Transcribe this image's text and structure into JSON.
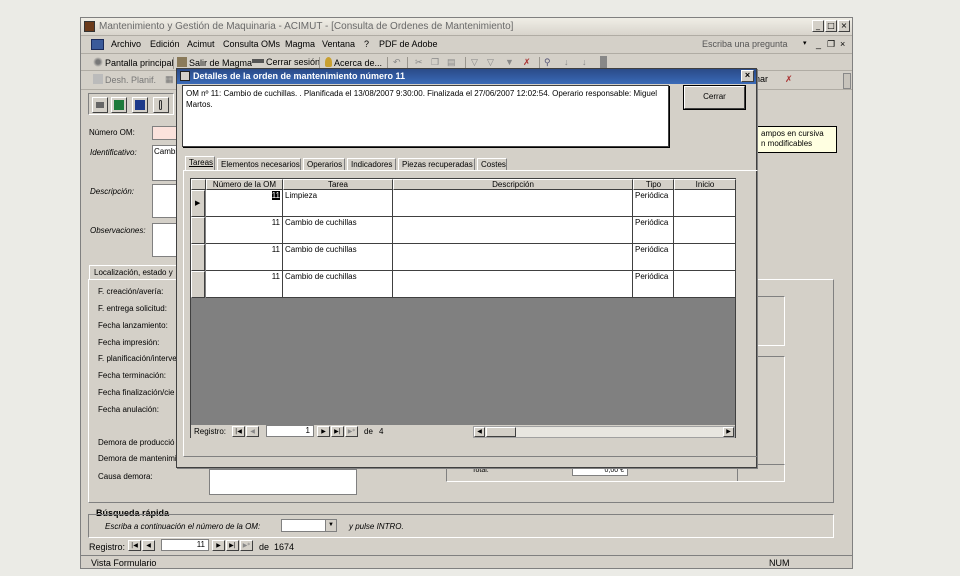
{
  "app": {
    "title": "Mantenimiento y Gestión de Maquinaria - ACIMUT - [Consulta de Ordenes de Mantenimiento]",
    "min": "_",
    "restore": "□",
    "close": "×"
  },
  "menu": {
    "items": [
      "Archivo",
      "Edición",
      "Acimut",
      "Consulta OMs",
      "Magma",
      "Ventana",
      "?",
      "PDF de Adobe"
    ],
    "help_placeholder": "Escriba una pregunta",
    "doc_min": "_",
    "doc_restore": "❐",
    "doc_close": "×"
  },
  "toolbar": {
    "pantalla": "Pantalla principal",
    "salir": "Salir de Magma",
    "cerrar_sesion": "Cerrar sesión",
    "acerca": "Acerca de..."
  },
  "toolbar2": {
    "desh": "Desh. Planif.",
    "right_label": "inar"
  },
  "form": {
    "numero_om": "Número OM:",
    "identificativo": "Identificativo:",
    "identificativo_value": "Cambi",
    "descripcion": "Descripción:",
    "observaciones": "Observaciones:",
    "tab_localizacion": "Localización, estado y",
    "note_text": "ampos en cursiva\nn modificables",
    "fields": [
      "F. creación/avería:",
      "F. entrega solicitud:",
      "Fecha lanzamiento:",
      "Fecha impresión:",
      "F. planificación/interve",
      "Fecha terminación:",
      "Fecha finalización/cie",
      "Fecha anulación:"
    ],
    "demora_produccion": "Demora de producció",
    "demora_mantenimiento": "Demora de mantenimie",
    "causa_demora": "Causa demora:",
    "total_label": "Total:",
    "total_value": "0,00 €",
    "busqueda_title": "Búsqueda rápida",
    "busqueda_prompt": "Escriba a continuación el número de la OM:",
    "busqueda_suffix": "y pulse INTRO.",
    "registro_label": "Registro:",
    "registro_current": "11",
    "registro_of": "de",
    "registro_total": "1674"
  },
  "status": {
    "left": "Vista Formulario",
    "num": "NUM"
  },
  "dialog": {
    "title": "Detalles de la orden de mantenimiento número 11",
    "close": "×",
    "summary": "OM nº 11: Cambio de cuchillas. . Planificada el 13/08/2007 9:30:00. Finalizada el 27/06/2007 12:02:54. Operario responsable: Miguel Martos.",
    "cerrar": "Cerrar",
    "tabs": [
      "Tareas",
      "Elementos necesarios",
      "Operarios",
      "Indicadores",
      "Piezas recuperadas",
      "Costes"
    ],
    "columns": [
      "Número de la OM",
      "Tarea",
      "Descripción",
      "Tipo",
      "Inicio"
    ],
    "rows": [
      [
        "11",
        "Limpieza",
        "",
        "Periódica",
        ""
      ],
      [
        "11",
        "Cambio de cuchillas",
        "",
        "Periódica",
        ""
      ],
      [
        "11",
        "Cambio de cuchillas",
        "",
        "Periódica",
        ""
      ],
      [
        "11",
        "Cambio de cuchillas",
        "",
        "Periódica",
        ""
      ]
    ],
    "registro_label": "Registro:",
    "registro_current": "1",
    "registro_of": "de",
    "registro_total": "4"
  }
}
